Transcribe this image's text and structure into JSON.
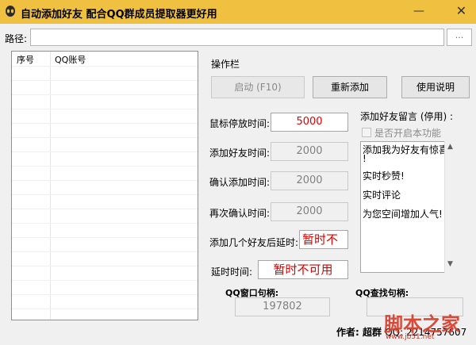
{
  "window": {
    "title": "自动添加好友  配合QQ群成员提取器更好用",
    "min_glyph": "—",
    "close_glyph": "✕",
    "accent": "#f0c040"
  },
  "path": {
    "label": "路径:",
    "value": "",
    "browse_label": "..."
  },
  "list": {
    "columns": [
      "序号",
      "QQ账号"
    ]
  },
  "ops": {
    "title": "操作栏",
    "start_button": "启动 (F10)",
    "readd_button": "重新添加",
    "help_button": "使用说明"
  },
  "timing": {
    "mouse_label": "鼠标停放时间:",
    "mouse_value": "5000",
    "add_label": "添加好友时间:",
    "add_value": "2000",
    "confirm_label": "确认添加时间:",
    "confirm_value": "2000",
    "reconfirm_label": "再次确认时间:",
    "reconfirm_value": "2000",
    "batch_label": "添加几个好友后延时:",
    "batch_value": "暂时不可",
    "delay_label": "延时时间:",
    "delay_value": "暂时不可用"
  },
  "message": {
    "title": "添加好友留言 (停用) :",
    "checkbox_label": "是否开启本功能",
    "lines": [
      "添加我为好友有惊喜",
      "!",
      "实时秒赞!",
      "实时评论",
      "为您空间增加人气!"
    ]
  },
  "handles": {
    "qq_window_label": "QQ窗口句柄:",
    "qq_window_value": "197802",
    "qq_find_label": "QQ查找句柄:",
    "qq_find_value": ""
  },
  "footer": {
    "author_label": "作者:",
    "author_name": "超群",
    "qq_text": "QQ: 2214757607"
  },
  "watermark": {
    "text": "脚本之家",
    "url": "www.jb51.net"
  }
}
